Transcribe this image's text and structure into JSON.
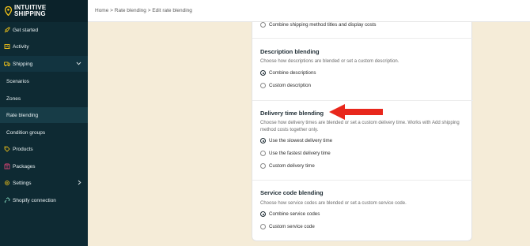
{
  "app": {
    "logo_line1": "INTUITIVE",
    "logo_line2": "SHIPPING"
  },
  "sidebar": {
    "items": [
      {
        "label": "Get started",
        "icon": "rocket-icon"
      },
      {
        "label": "Activity",
        "icon": "activity-icon"
      },
      {
        "label": "Shipping",
        "icon": "truck-icon",
        "chevron": "chevron-down-icon"
      },
      {
        "label": "Scenarios"
      },
      {
        "label": "Zones"
      },
      {
        "label": "Rate blending"
      },
      {
        "label": "Condition groups"
      },
      {
        "label": "Products",
        "icon": "tag-icon"
      },
      {
        "label": "Packages",
        "icon": "package-icon"
      },
      {
        "label": "Settings",
        "icon": "gear-icon",
        "chevron": "chevron-right-icon"
      },
      {
        "label": "Shopify connection",
        "icon": "link-icon"
      }
    ]
  },
  "breadcrumb": {
    "home": "Home",
    "sep": ">",
    "rate_blending": "Rate blending",
    "current": "Edit rate blending"
  },
  "card": {
    "top_option": "Combine shipping method titles and display costs",
    "description": {
      "title": "Description blending",
      "desc": "Choose how descriptions are blended or set a custom description.",
      "options": [
        "Combine descriptions",
        "Custom description"
      ],
      "selected": 0
    },
    "delivery": {
      "title": "Delivery time blending",
      "desc": "Choose how delivery times are blended or set a custom delivery time. Works with Add shipping method costs together only.",
      "options": [
        "Use the slowest delivery time",
        "Use the fastest delivery time",
        "Custom delivery time"
      ],
      "selected": 0
    },
    "service": {
      "title": "Service code blending",
      "desc": "Choose how service codes are blended or set a custom service code.",
      "options": [
        "Combine service codes",
        "Custom service code"
      ],
      "selected": 0
    }
  },
  "colors": {
    "sidebar_bg": "#0e2a33",
    "page_bg": "#f5ecd8",
    "arrow": "#e8271c",
    "logo_pin": "#f5c518"
  }
}
